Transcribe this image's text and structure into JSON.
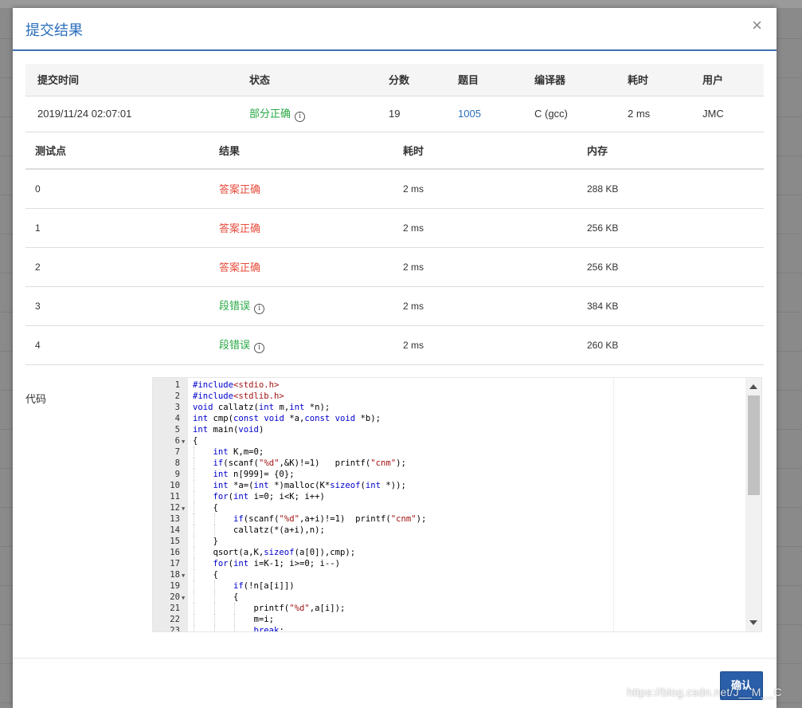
{
  "modal": {
    "title": "提交结果",
    "close_label": "×",
    "confirm_label": "确认"
  },
  "summary": {
    "headers": [
      "提交时间",
      "状态",
      "分数",
      "题目",
      "编译器",
      "耗时",
      "用户"
    ],
    "row": {
      "time": "2019/11/24 02:07:01",
      "status": "部分正确",
      "score": "19",
      "problem": "1005",
      "compiler": "C (gcc)",
      "elapsed": "2 ms",
      "user": "JMC"
    }
  },
  "cases": {
    "headers": [
      "测试点",
      "结果",
      "耗时",
      "内存"
    ],
    "rows": [
      {
        "id": "0",
        "result": "答案正确",
        "time": "2 ms",
        "memory": "288 KB"
      },
      {
        "id": "1",
        "result": "答案正确",
        "time": "2 ms",
        "memory": "256 KB"
      },
      {
        "id": "2",
        "result": "答案正确",
        "time": "2 ms",
        "memory": "256 KB"
      },
      {
        "id": "3",
        "result": "段错误",
        "time": "2 ms",
        "memory": "384 KB"
      },
      {
        "id": "4",
        "result": "段错误",
        "time": "2 ms",
        "memory": "260 KB"
      }
    ]
  },
  "code": {
    "label": "代码",
    "lines": [
      "#include<stdio.h>",
      "#include<stdlib.h>",
      "void callatz(int m,int *n);",
      "int cmp(const void *a,const void *b);",
      "int main(void)",
      "{",
      "    int K,m=0;",
      "    if(scanf(\"%d\",&K)!=1)   printf(\"cnm\");",
      "    int n[999]= {0};",
      "    int *a=(int *)malloc(K*sizeof(int *));",
      "    for(int i=0; i<K; i++)",
      "    {",
      "        if(scanf(\"%d\",a+i)!=1)  printf(\"cnm\");",
      "        callatz(*(a+i),n);",
      "    }",
      "    qsort(a,K,sizeof(a[0]),cmp);",
      "    for(int i=K-1; i>=0; i--)",
      "    {",
      "        if(!n[a[i]])",
      "        {",
      "            printf(\"%d\",a[i]);",
      "            m=i;",
      "            break;"
    ],
    "fold_lines": [
      6,
      12,
      18,
      20
    ]
  },
  "watermark": "https://blog.csdn.net/J__M__C",
  "colors": {
    "accent": "#2a6ebb",
    "accepted": "#e74c3c",
    "partial": "#27a844"
  }
}
